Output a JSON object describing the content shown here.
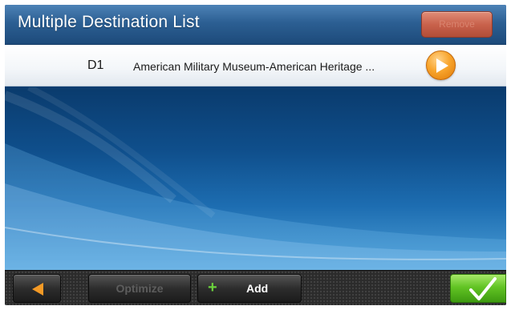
{
  "header": {
    "title": "Multiple Destination List",
    "remove_label": "Remove"
  },
  "list": {
    "items": [
      {
        "id": "D1",
        "name": "American Military Museum-American Heritage ..."
      }
    ]
  },
  "footer": {
    "optimize_label": "Optimize",
    "add_label": "Add"
  },
  "icons": {
    "back": "back-arrow-icon",
    "go": "play-arrow-icon",
    "add": "plus-icon",
    "confirm": "checkmark-icon"
  },
  "colors": {
    "header": "#2c5f93",
    "accent_orange": "#f8a52d",
    "confirm_green": "#62c424",
    "remove_red": "#c9624c"
  }
}
